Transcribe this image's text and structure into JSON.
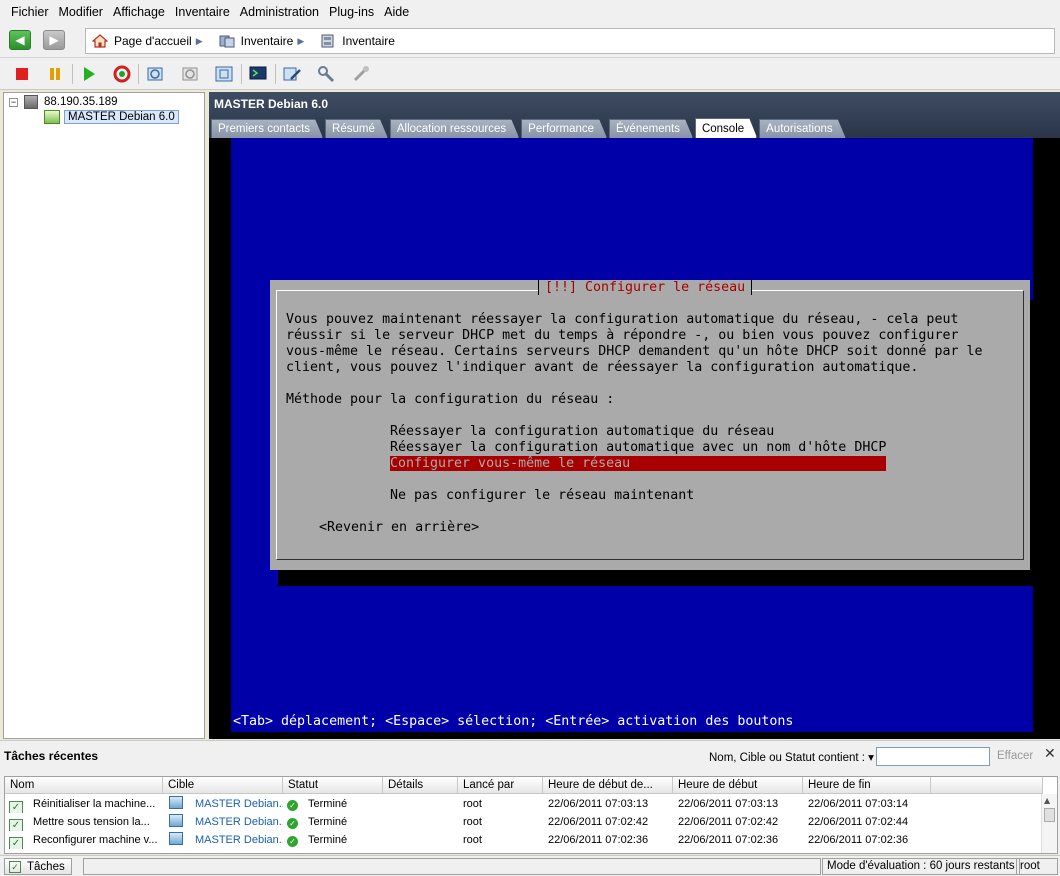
{
  "menu": [
    "Fichier",
    "Modifier",
    "Affichage",
    "Inventaire",
    "Administration",
    "Plug-ins",
    "Aide"
  ],
  "breadcrumb": [
    "Page d'accueil",
    "Inventaire",
    "Inventaire"
  ],
  "tree": {
    "host": "88.190.35.189",
    "vm": "MASTER Debian 6.0"
  },
  "vm_panel": {
    "title": "MASTER Debian 6.0",
    "tabs": [
      "Premiers contacts",
      "Résumé",
      "Allocation ressources",
      "Performance",
      "Événements",
      "Console",
      "Autorisations"
    ],
    "active_tab": "Console"
  },
  "console": {
    "dialog_title": "[!!] Configurer le réseau",
    "text_lines": [
      "Vous pouvez maintenant réessayer la configuration automatique du réseau, - cela peut",
      "réussir si le serveur DHCP met du temps à répondre -, ou bien vous pouvez configurer",
      "vous-même le réseau. Certains serveurs DHCP demandent qu'un hôte DHCP soit donné par le",
      "client, vous pouvez l'indiquer avant de réessayer la configuration automatique."
    ],
    "method_label": "Méthode pour la configuration du réseau :",
    "options": [
      "Réessayer la configuration automatique du réseau",
      "Réessayer la configuration automatique avec un nom d'hôte DHCP",
      "Configurer vous-même le réseau",
      "Ne pas configurer le réseau maintenant"
    ],
    "selected_option": "Configurer vous-même le réseau",
    "back_button": "<Revenir en arrière>",
    "status_line": "<Tab> déplacement; <Espace> sélection; <Entrée> activation des boutons"
  },
  "recent_tasks": {
    "title": "Tâches récentes",
    "filter_label": "Nom, Cible ou Statut contient : ▾",
    "filter_value": "",
    "clear_label": "Effacer",
    "columns": [
      "Nom",
      "Cible",
      "Statut",
      "Détails",
      "Lancé par",
      "Heure de début de...",
      "Heure de début",
      "Heure de fin"
    ],
    "rows": [
      {
        "name": "Réinitialiser la machine...",
        "target": "MASTER Debian...",
        "status": "Terminé",
        "details": "",
        "user": "root",
        "requested": "22/06/2011 07:03:13",
        "start": "22/06/2011 07:03:13",
        "end": "22/06/2011 07:03:14"
      },
      {
        "name": "Mettre sous tension la...",
        "target": "MASTER Debian...",
        "status": "Terminé",
        "details": "",
        "user": "root",
        "requested": "22/06/2011 07:02:42",
        "start": "22/06/2011 07:02:42",
        "end": "22/06/2011 07:02:44"
      },
      {
        "name": "Reconfigurer machine v...",
        "target": "MASTER Debian...",
        "status": "Terminé",
        "details": "",
        "user": "root",
        "requested": "22/06/2011 07:02:36",
        "start": "22/06/2011 07:02:36",
        "end": "22/06/2011 07:02:36"
      }
    ]
  },
  "statusbar": {
    "tasks_label": "Tâches",
    "eval": "Mode d'évaluation : 60 jours restants",
    "user": "root"
  },
  "colors": {
    "console_blue": "#0000a8",
    "dialog_gray": "#aaaaaa",
    "selection_red": "#a80000",
    "header_dark": "#2a3548"
  }
}
